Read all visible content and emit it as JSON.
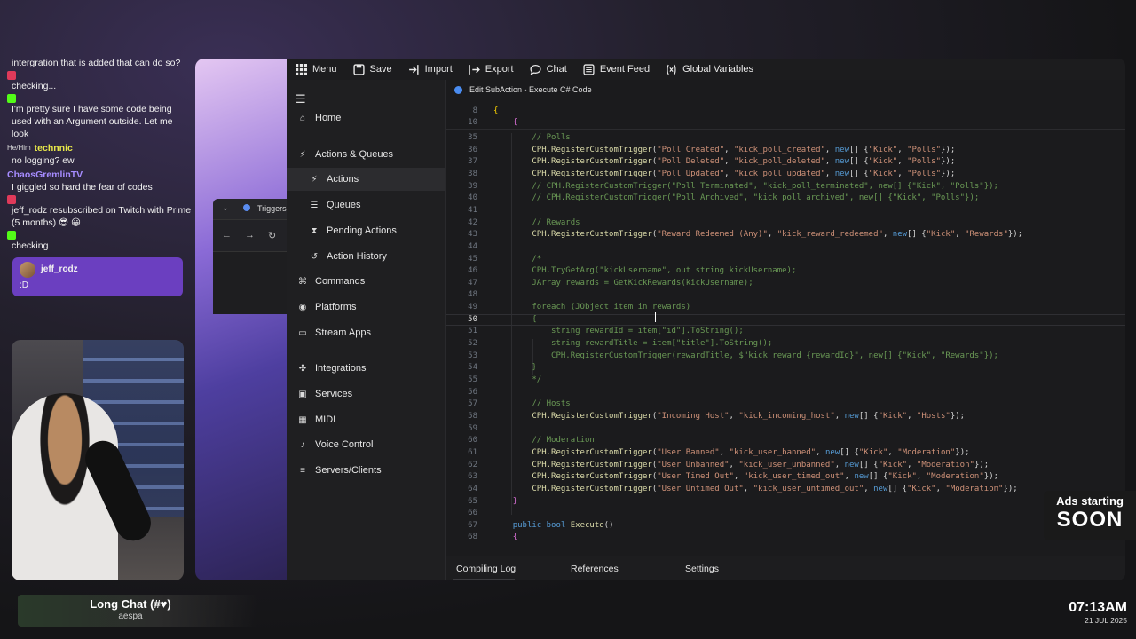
{
  "chat": {
    "messages": [
      {
        "user": "",
        "text": "intergration that is added that can do so?"
      },
      {
        "user": "",
        "badge_color": "#e03a5a",
        "text": "checking..."
      },
      {
        "user": "",
        "badge_color": "#53fc18",
        "text": "I'm pretty sure I have some code being used with an Argument outside. Let me look"
      },
      {
        "user": "technnic",
        "pronouns": "He/Him",
        "text": "no logging? ew"
      },
      {
        "user": "ChaosGremlinTV",
        "text": "I giggled so hard the fear of codes"
      },
      {
        "user": "",
        "badge_color": "#e03a5a",
        "text": "jeff_rodz resubscribed on Twitch with Prime (5 months) 😎 😀"
      },
      {
        "user": "",
        "badge_color": "#53fc18",
        "text": "checking"
      }
    ],
    "highlight": {
      "user": "jeff_rodz",
      "text": ":D"
    }
  },
  "bottom": {
    "title": "Long Chat (#♥)",
    "subtitle": "aespa"
  },
  "bg_window": {
    "tab_label": "Triggers"
  },
  "menubar": {
    "items": [
      {
        "label": "Menu",
        "icon": "grid-icon"
      },
      {
        "label": "Save",
        "icon": "save-icon"
      },
      {
        "label": "Import",
        "icon": "import-icon"
      },
      {
        "label": "Export",
        "icon": "export-icon"
      },
      {
        "label": "Chat",
        "icon": "chat-icon"
      },
      {
        "label": "Event Feed",
        "icon": "list-icon"
      },
      {
        "label": "Global Variables",
        "icon": "variable-icon"
      }
    ]
  },
  "sidebar": {
    "items": [
      {
        "label": "Home",
        "icon": "home-icon",
        "sub": false
      },
      {
        "label": "Actions & Queues",
        "icon": "bolt-icon",
        "sub": false
      },
      {
        "label": "Actions",
        "icon": "bolt-icon",
        "sub": true,
        "active": true
      },
      {
        "label": "Queues",
        "icon": "queue-icon",
        "sub": true
      },
      {
        "label": "Pending Actions",
        "icon": "pending-icon",
        "sub": true
      },
      {
        "label": "Action History",
        "icon": "history-icon",
        "sub": true
      },
      {
        "label": "Commands",
        "icon": "command-icon",
        "sub": false
      },
      {
        "label": "Platforms",
        "icon": "platforms-icon",
        "sub": false
      },
      {
        "label": "Stream Apps",
        "icon": "apps-icon",
        "sub": false
      },
      {
        "label": "Integrations",
        "icon": "integrations-icon",
        "sub": false
      },
      {
        "label": "Services",
        "icon": "services-icon",
        "sub": false
      },
      {
        "label": "MIDI",
        "icon": "midi-icon",
        "sub": false
      },
      {
        "label": "Voice Control",
        "icon": "mic-icon",
        "sub": false
      },
      {
        "label": "Servers/Clients",
        "icon": "server-icon",
        "sub": false
      }
    ]
  },
  "editor": {
    "title": "Edit SubAction - Execute C# Code",
    "sticky_lines": [
      {
        "n": "8",
        "html": "<span class='k-br'>{</span>"
      },
      {
        "n": "10",
        "html": "    <span class='k-br2'>{</span>"
      }
    ],
    "current_line": "50",
    "lines": [
      {
        "n": "35",
        "html": "        <span class='k-cm'>// Polls</span>"
      },
      {
        "n": "36",
        "html": "        <span class='k-fn'>CPH.RegisterCustomTrigger</span>(<span class='k-str'>\"Poll Created\"</span>, <span class='k-str'>\"kick_poll_created\"</span>, <span class='k-kw'>new</span>[] {<span class='k-str'>\"Kick\"</span>, <span class='k-str'>\"Polls\"</span>});"
      },
      {
        "n": "37",
        "html": "        <span class='k-fn'>CPH.RegisterCustomTrigger</span>(<span class='k-str'>\"Poll Deleted\"</span>, <span class='k-str'>\"kick_poll_deleted\"</span>, <span class='k-kw'>new</span>[] {<span class='k-str'>\"Kick\"</span>, <span class='k-str'>\"Polls\"</span>});"
      },
      {
        "n": "38",
        "html": "        <span class='k-fn'>CPH.RegisterCustomTrigger</span>(<span class='k-str'>\"Poll Updated\"</span>, <span class='k-str'>\"kick_poll_updated\"</span>, <span class='k-kw'>new</span>[] {<span class='k-str'>\"Kick\"</span>, <span class='k-str'>\"Polls\"</span>});"
      },
      {
        "n": "39",
        "html": "        <span class='k-cm'>// CPH.RegisterCustomTrigger(\"Poll Terminated\", \"kick_poll_terminated\", new[] {\"Kick\", \"Polls\"});</span>"
      },
      {
        "n": "40",
        "html": "        <span class='k-cm'>// CPH.RegisterCustomTrigger(\"Poll Archived\", \"kick_poll_archived\", new[] {\"Kick\", \"Polls\"});</span>"
      },
      {
        "n": "41",
        "html": ""
      },
      {
        "n": "42",
        "html": "        <span class='k-cm'>// Rewards</span>"
      },
      {
        "n": "43",
        "html": "        <span class='k-fn'>CPH.RegisterCustomTrigger</span>(<span class='k-str'>\"Reward Redeemed (Any)\"</span>, <span class='k-str'>\"kick_reward_redeemed\"</span>, <span class='k-kw'>new</span>[] {<span class='k-str'>\"Kick\"</span>, <span class='k-str'>\"Rewards\"</span>});"
      },
      {
        "n": "44",
        "html": ""
      },
      {
        "n": "45",
        "html": "        <span class='k-cm'>/*</span>"
      },
      {
        "n": "46",
        "html": "        <span class='k-cm'>CPH.TryGetArg(\"kickUsername\", out string kickUsername);</span>"
      },
      {
        "n": "47",
        "html": "        <span class='k-cm'>JArray rewards = GetKickRewards(kickUsername);</span>"
      },
      {
        "n": "48",
        "html": ""
      },
      {
        "n": "49",
        "html": "        <span class='k-cm'>foreach (JObject item in rewards)</span>"
      },
      {
        "n": "50",
        "html": "        <span class='k-cm'>{</span>"
      },
      {
        "n": "51",
        "html": "            <span class='k-cm'>string rewardId = item[\"id\"].ToString();</span>"
      },
      {
        "n": "52",
        "html": "            <span class='k-cm'>string rewardTitle = item[\"title\"].ToString();</span>"
      },
      {
        "n": "53",
        "html": "            <span class='k-cm'>CPH.RegisterCustomTrigger(rewardTitle, $\"kick_reward_{rewardId}\", new[] {\"Kick\", \"Rewards\"});</span>"
      },
      {
        "n": "54",
        "html": "        <span class='k-cm'>}</span>"
      },
      {
        "n": "55",
        "html": "        <span class='k-cm'>*/</span>"
      },
      {
        "n": "56",
        "html": ""
      },
      {
        "n": "57",
        "html": "        <span class='k-cm'>// Hosts</span>"
      },
      {
        "n": "58",
        "html": "        <span class='k-fn'>CPH.RegisterCustomTrigger</span>(<span class='k-str'>\"Incoming Host\"</span>, <span class='k-str'>\"kick_incoming_host\"</span>, <span class='k-kw'>new</span>[] {<span class='k-str'>\"Kick\"</span>, <span class='k-str'>\"Hosts\"</span>});"
      },
      {
        "n": "59",
        "html": ""
      },
      {
        "n": "60",
        "html": "        <span class='k-cm'>// Moderation</span>"
      },
      {
        "n": "61",
        "html": "        <span class='k-fn'>CPH.RegisterCustomTrigger</span>(<span class='k-str'>\"User Banned\"</span>, <span class='k-str'>\"kick_user_banned\"</span>, <span class='k-kw'>new</span>[] {<span class='k-str'>\"Kick\"</span>, <span class='k-str'>\"Moderation\"</span>});"
      },
      {
        "n": "62",
        "html": "        <span class='k-fn'>CPH.RegisterCustomTrigger</span>(<span class='k-str'>\"User Unbanned\"</span>, <span class='k-str'>\"kick_user_unbanned\"</span>, <span class='k-kw'>new</span>[] {<span class='k-str'>\"Kick\"</span>, <span class='k-str'>\"Moderation\"</span>});"
      },
      {
        "n": "63",
        "html": "        <span class='k-fn'>CPH.RegisterCustomTrigger</span>(<span class='k-str'>\"User Timed Out\"</span>, <span class='k-str'>\"kick_user_timed_out\"</span>, <span class='k-kw'>new</span>[] {<span class='k-str'>\"Kick\"</span>, <span class='k-str'>\"Moderation\"</span>});"
      },
      {
        "n": "64",
        "html": "        <span class='k-fn'>CPH.RegisterCustomTrigger</span>(<span class='k-str'>\"User Untimed Out\"</span>, <span class='k-str'>\"kick_user_untimed_out\"</span>, <span class='k-kw'>new</span>[] {<span class='k-str'>\"Kick\"</span>, <span class='k-str'>\"Moderation\"</span>});"
      },
      {
        "n": "65",
        "html": "    <span class='k-br2'>}</span>"
      },
      {
        "n": "66",
        "html": ""
      },
      {
        "n": "67",
        "html": "    <span class='k-kw'>public</span> <span class='k-kw'>bool</span> <span class='k-fn'>Execute</span>()"
      },
      {
        "n": "68",
        "html": "    <span class='k-br2'>{</span>"
      }
    ],
    "tabs": [
      "Compiling Log",
      "References",
      "Settings"
    ]
  },
  "ads": {
    "line1": "Ads starting",
    "line2": "SOON"
  },
  "clock": {
    "time": "07:13AM",
    "date": "21 JUL 2025"
  }
}
